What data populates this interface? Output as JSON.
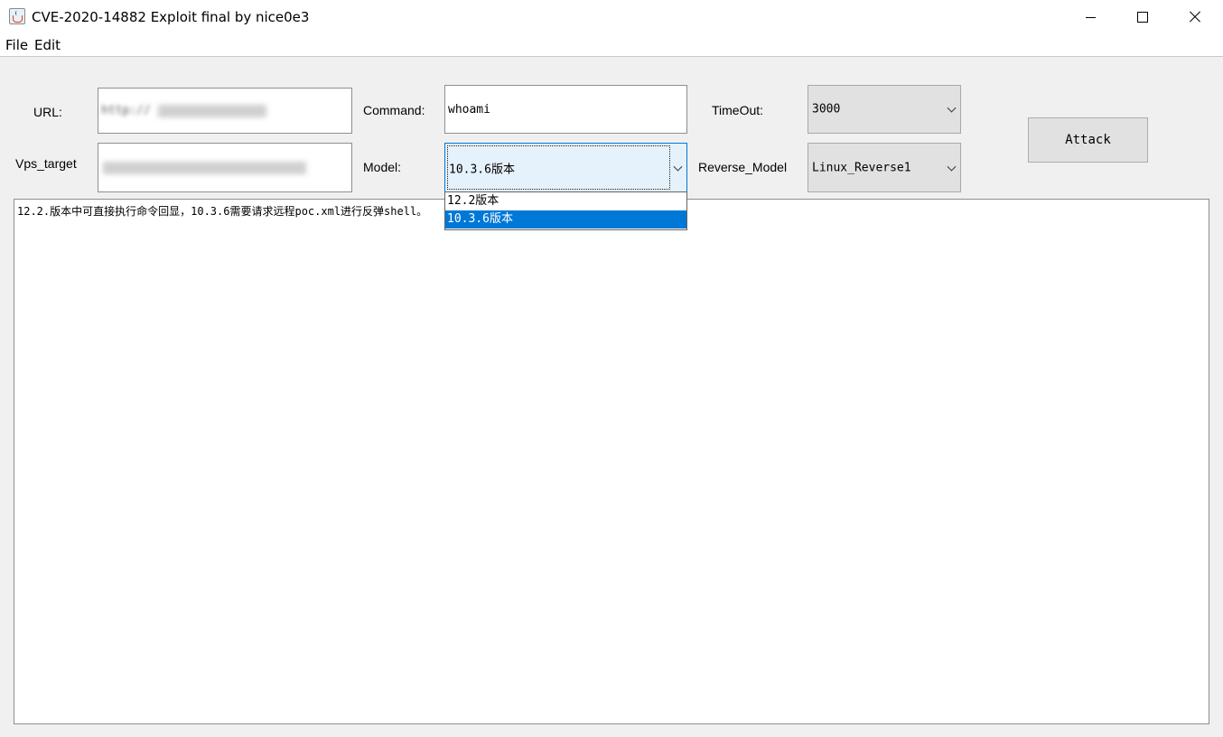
{
  "window": {
    "title": "CVE-2020-14882 Exploit final by nice0e3"
  },
  "menu": {
    "items": [
      "File",
      "Edit"
    ]
  },
  "form": {
    "url_label": "URL:",
    "url_value": "http://",
    "command_label": "Command:",
    "command_value": "whoami",
    "timeout_label": "TimeOut:",
    "timeout_value": "3000",
    "vps_label": "Vps_target",
    "vps_value": "",
    "model_label": "Model:",
    "model_value": "10.3.6版本",
    "model_options": [
      "12.2版本",
      "10.3.6版本"
    ],
    "model_selected_index": 1,
    "reverse_label": "Reverse_Model",
    "reverse_value": "Linux_Reverse1",
    "attack_button": "Attack"
  },
  "output": {
    "text": "12.2.版本中可直接执行命令回显，10.3.6需要请求远程poc.xml进行反弹shell。"
  },
  "icons": {
    "app": "java-cup-icon",
    "minimize": "minimize-icon",
    "maximize": "maximize-icon",
    "close": "close-icon",
    "dropdown": "chevron-down-icon"
  },
  "colors": {
    "selection": "#0078d7",
    "combo_active_bg": "#e5f1fb",
    "window_bg": "#f0f0f0"
  }
}
